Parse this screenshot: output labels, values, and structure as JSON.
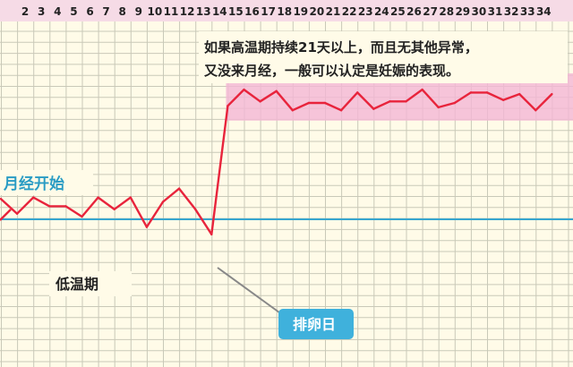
{
  "chart_data": {
    "type": "line",
    "days": [
      2,
      3,
      4,
      5,
      6,
      7,
      8,
      9,
      10,
      11,
      12,
      13,
      14,
      15,
      16,
      17,
      18,
      19,
      20,
      21,
      22,
      23,
      24,
      25,
      26,
      27,
      28,
      29,
      30,
      31,
      32,
      33,
      34
    ],
    "series": [
      {
        "x": [
          1,
          2,
          3,
          4,
          5,
          6,
          7,
          8,
          9,
          10,
          11,
          12,
          13,
          14,
          15,
          16,
          17,
          18,
          19,
          20,
          21,
          22,
          23,
          24,
          25,
          26,
          27,
          28,
          29,
          30,
          31,
          32,
          33,
          34,
          35
        ],
        "values": [
          36.32,
          36.22,
          36.33,
          36.27,
          36.27,
          36.2,
          36.33,
          36.25,
          36.33,
          36.13,
          36.3,
          36.39,
          36.25,
          36.08,
          36.95,
          37.06,
          36.98,
          37.05,
          36.92,
          36.97,
          36.97,
          36.92,
          37.04,
          36.93,
          36.98,
          36.98,
          37.06,
          36.94,
          36.97,
          37.04,
          37.04,
          36.99,
          37.03,
          36.92,
          37.03
        ]
      }
    ],
    "baseline_label": "月经开始",
    "low_phase_label": "低温期",
    "ovulation_label": "排卵日",
    "ovulation_day": 14,
    "high_phase_band": {
      "from": 15,
      "to": 35
    },
    "note_lines": [
      "如果高温期持续21天以上，而且无其他异常，",
      "又没来月经，一般可以认定是妊娠的表现。"
    ],
    "colors": {
      "background": "#fffbe8",
      "grid": "#c9c9b8",
      "header": "#f6dbe6",
      "line": "#e8243c",
      "band": "#f4b7d5",
      "baseline": "#37a6cf",
      "badge": "#3fb1dc"
    }
  }
}
